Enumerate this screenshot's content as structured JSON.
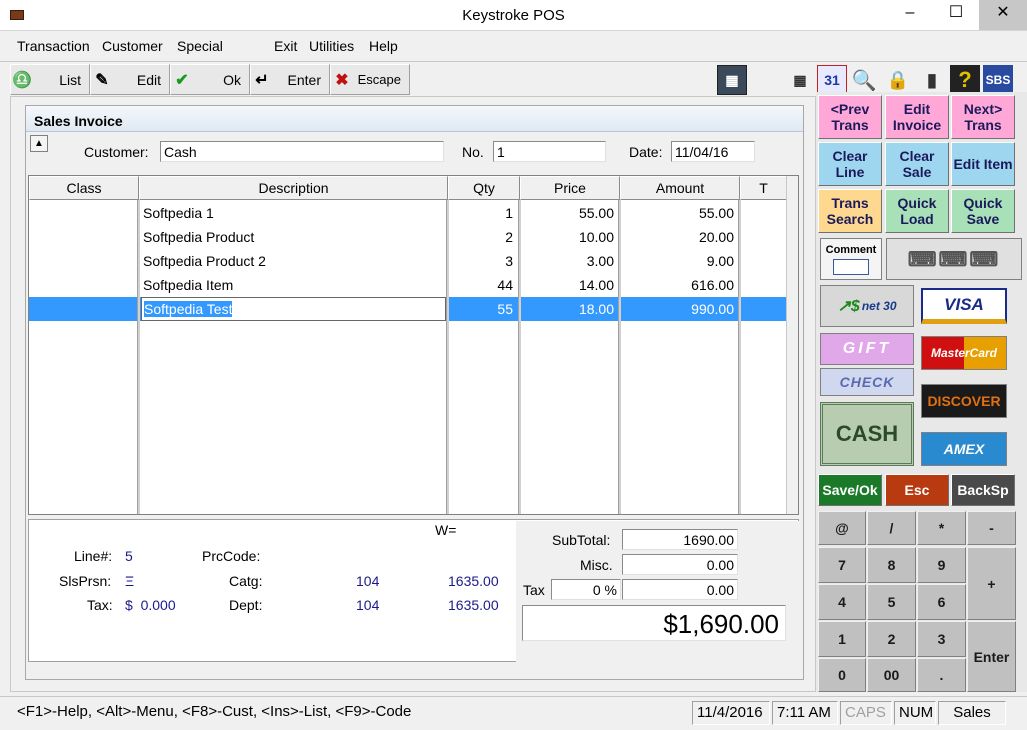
{
  "window": {
    "title": "Keystroke POS",
    "minimize": "–",
    "maximize": "☐",
    "close": "✕"
  },
  "menu": [
    "Transaction",
    "Customer",
    "Special",
    "Exit",
    "Utilities",
    "Help"
  ],
  "toolbar": {
    "list": "List",
    "edit": "Edit",
    "ok": "Ok",
    "enter": "Enter",
    "escape": "Escape"
  },
  "invoice": {
    "title": "Sales Invoice",
    "customer_label": "Customer:",
    "customer": "Cash",
    "no_label": "No.",
    "no": "1",
    "date_label": "Date:",
    "date": "11/04/16",
    "columns": [
      "Class",
      "Description",
      "Qty",
      "Price",
      "Amount",
      "T"
    ],
    "rows": [
      {
        "desc": "Softpedia 1",
        "qty": "1",
        "price": "55.00",
        "amount": "55.00"
      },
      {
        "desc": "Softpedia Product",
        "qty": "2",
        "price": "10.00",
        "amount": "20.00"
      },
      {
        "desc": "Softpedia Product 2",
        "qty": "3",
        "price": "3.00",
        "amount": "9.00"
      },
      {
        "desc": "Softpedia Item",
        "qty": "44",
        "price": "14.00",
        "amount": "616.00"
      },
      {
        "desc": "Softpedia Test",
        "qty": "55",
        "price": "18.00",
        "amount": "990.00"
      }
    ]
  },
  "details": {
    "w_label": "W=",
    "line_label": "Line#:",
    "line": "5",
    "prccode_label": "PrcCode:",
    "slsprsn_label": "SlsPrsn:",
    "slsprsn": "Ξ",
    "catg_label": "Catg:",
    "catg_code": "104",
    "catg_amount": "1635.00",
    "tax_label": "Tax:",
    "tax_value": "$  0.000",
    "dept_label": "Dept:",
    "dept_code": "104",
    "dept_amount": "1635.00"
  },
  "totals": {
    "subtotal_label": "SubTotal:",
    "subtotal": "1690.00",
    "misc_label": "Misc.",
    "misc": "0.00",
    "tax_label": "Tax",
    "tax_pct": "0 %",
    "tax": "0.00",
    "total": "$1,690.00"
  },
  "keypad": {
    "prev": "<Prev Trans",
    "edit_invoice": "Edit Invoice",
    "next": "Next> Trans",
    "clear_line": "Clear Line",
    "clear_sale": "Clear Sale",
    "edit_item": "Edit Item",
    "trans_search": "Trans Search",
    "quick_load": "Quick Load",
    "quick_save": "Quick Save",
    "comment": "Comment",
    "net30": "net 30",
    "visa": "VISA",
    "gift": "GIFT",
    "mastercard": "MasterCard",
    "check": "CHECK",
    "discover": "DISCOVER",
    "cash": "CASH",
    "amex": "AMEX",
    "save_ok": "Save/Ok",
    "esc": "Esc",
    "backsp": "BackSp",
    "keys": [
      "@",
      "/",
      "*",
      "-",
      "7",
      "8",
      "9",
      "+",
      "4",
      "5",
      "6",
      "1",
      "2",
      "3",
      "Enter",
      "0",
      "00",
      "."
    ]
  },
  "status": {
    "help": "<F1>-Help, <Alt>-Menu, <F8>-Cust, <Ins>-List, <F9>-Code",
    "date": "11/4/2016",
    "time": "7:11 AM",
    "caps": "CAPS",
    "num": "NUM",
    "mode": "Sales"
  },
  "colors": {
    "selection": "#3399ff",
    "pink": "#ffa8d8",
    "cyan": "#9ed6f0",
    "green": "#a8e0b8",
    "saveok": "#1a7a2a",
    "esc": "#b83a10"
  }
}
